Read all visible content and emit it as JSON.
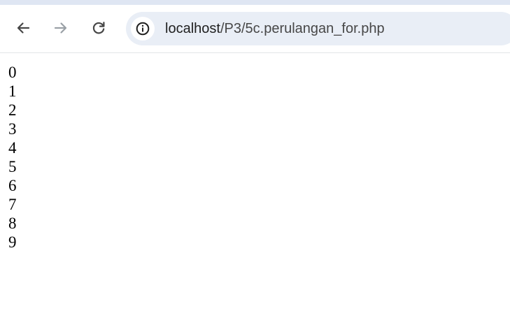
{
  "browser": {
    "url": {
      "host": "localhost",
      "path": "/P3/5c.perulangan_for.php"
    },
    "icons": {
      "back": "arrow-left-icon",
      "forward": "arrow-right-icon",
      "reload": "reload-icon",
      "site_info": "info-icon"
    },
    "colors": {
      "toolbar_icon": "#474747",
      "disabled_icon": "#9aa0a6",
      "omnibox_bg": "#e9eef6"
    }
  },
  "page": {
    "output_lines": [
      "0",
      "1",
      "2",
      "3",
      "4",
      "5",
      "6",
      "7",
      "8",
      "9"
    ]
  }
}
